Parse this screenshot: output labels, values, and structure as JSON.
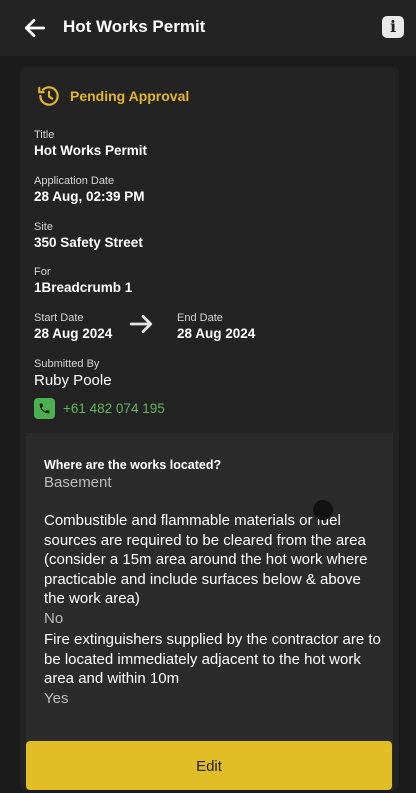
{
  "header": {
    "title": "Hot Works Permit",
    "back_icon": "arrow-left-icon",
    "info_icon": "info-icon",
    "info_glyph": "i"
  },
  "status": {
    "label": "Pending Approval",
    "icon": "history-clock-icon",
    "color": "#e3b52b"
  },
  "details": {
    "title_label": "Title",
    "title_value": "Hot Works Permit",
    "app_date_label": "Application Date",
    "app_date_value": "28 Aug, 02:39 PM",
    "site_label": "Site",
    "site_value": "350 Safety Street",
    "for_label": "For",
    "for_value": "1Breadcrumb 1",
    "start_label": "Start Date",
    "start_value": "28 Aug 2024",
    "end_label": "End Date",
    "end_value": "28 Aug 2024",
    "submitted_label": "Submitted By",
    "submitted_value": "Ruby Poole",
    "phone": "+61 482 074 195"
  },
  "questions": [
    {
      "q": "Where are the works located?",
      "a": "Basement"
    },
    {
      "q": "Combustible and flammable materials or fuel sources are required to be cleared from the area (consider a 15m area around the hot work where practicable and include surfaces below & above the work area)",
      "a": "No"
    },
    {
      "q": "Fire extinguishers supplied by the contractor are to be located immediately adjacent to the hot work area and within 10m",
      "a": "Yes"
    }
  ],
  "edit_label": "Edit",
  "colors": {
    "accent": "#e1bd26",
    "phone_green": "#4caf50"
  }
}
